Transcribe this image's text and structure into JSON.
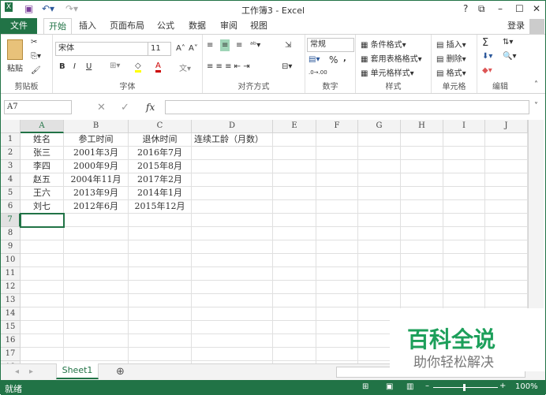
{
  "title": "工作簿3 - Excel",
  "window_buttons": [
    "?",
    "⧉",
    "–",
    "☐",
    "✕"
  ],
  "tabs": {
    "file": "文件",
    "items": [
      "开始",
      "插入",
      "页面布局",
      "公式",
      "数据",
      "审阅",
      "视图"
    ],
    "login": "登录"
  },
  "ribbon": {
    "clipboard": {
      "paste": "粘贴",
      "label": "剪贴板"
    },
    "font": {
      "name": "宋体",
      "size": "11",
      "bold": "B",
      "italic": "I",
      "underline": "U",
      "label": "字体",
      "grow": "A˄",
      "shrink": "A˅"
    },
    "alignment": {
      "label": "对齐方式"
    },
    "number": {
      "format": "常规",
      "percent": "%",
      "comma": ",",
      "label": "数字"
    },
    "styles": {
      "items": [
        "条件格式",
        "套用表格格式",
        "单元格样式"
      ],
      "label": "样式"
    },
    "cells": {
      "items": [
        "插入",
        "删除",
        "格式"
      ],
      "label": "单元格"
    },
    "editing": {
      "label": "编辑",
      "sum": "Σ"
    }
  },
  "formula_bar": {
    "name_box": "A7",
    "fx": "fx",
    "value": ""
  },
  "columns": [
    "A",
    "B",
    "C",
    "D",
    "E",
    "F",
    "G",
    "H",
    "I",
    "J"
  ],
  "rows": [
    [
      "姓名",
      "参工时间",
      "退休时间",
      "连续工龄（月数）"
    ],
    [
      "张三",
      "2001年3月",
      "2016年7月",
      ""
    ],
    [
      "李四",
      "2000年9月",
      "2015年8月",
      ""
    ],
    [
      "赵五",
      "2004年11月",
      "2017年2月",
      ""
    ],
    [
      "王六",
      "2013年9月",
      "2014年1月",
      ""
    ],
    [
      "刘七",
      "2012年6月",
      "2015年12月",
      ""
    ]
  ],
  "row_count": 18,
  "selected_cell": "A7",
  "sheets": [
    "Sheet1"
  ],
  "status": {
    "text": "就绪",
    "zoom": "100%"
  },
  "watermark": {
    "title": "百科全说",
    "subtitle": "助你轻松解决"
  },
  "colors": {
    "accent": "#217346"
  }
}
